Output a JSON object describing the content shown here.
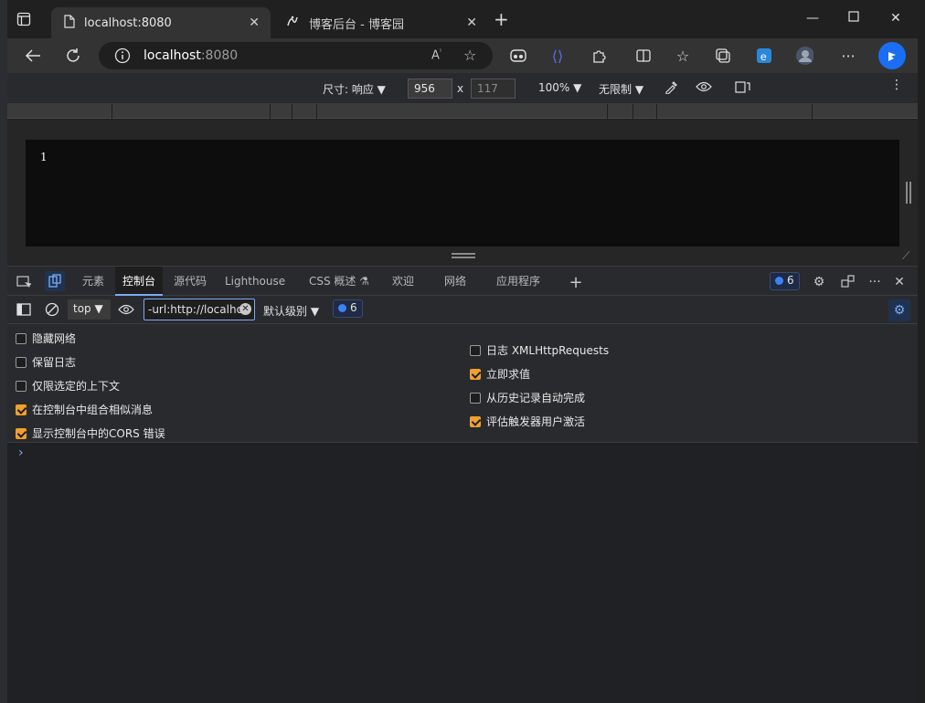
{
  "tabs": [
    {
      "title": "localhost:8080",
      "active": true
    },
    {
      "title": "博客后台 - 博客园",
      "active": false
    }
  ],
  "address": {
    "host": "localhost",
    "port": ":8080"
  },
  "device_toolbar": {
    "dimensions_label": "尺寸: 响应",
    "width": "956",
    "times": "x",
    "height": "117",
    "zoom": "100%",
    "throttle": "无限制"
  },
  "page": {
    "content": "1"
  },
  "devtools": {
    "tabs": [
      "元素",
      "控制台",
      "源代码",
      "Lighthouse",
      "CSS 概述",
      "欢迎",
      "网络",
      "应用程序"
    ],
    "active_tab": "控制台",
    "issues_count": "6"
  },
  "console_bar": {
    "context": "top",
    "filter_value": "-url:http://localhos",
    "levels": "默认级别",
    "issues_count": "6"
  },
  "settings": {
    "left": [
      {
        "label": "隐藏网络",
        "checked": false
      },
      {
        "label": "保留日志",
        "checked": false
      },
      {
        "label": "仅限选定的上下文",
        "checked": false
      },
      {
        "label": "在控制台中组合相似消息",
        "checked": true
      },
      {
        "label": "显示控制台中的CORS 错误",
        "checked": true
      }
    ],
    "right": [
      {
        "label": "日志 XMLHttpRequests",
        "checked": false
      },
      {
        "label": "立即求值",
        "checked": true
      },
      {
        "label": "从历史记录自动完成",
        "checked": false
      },
      {
        "label": "评估触发器用户激活",
        "checked": true
      }
    ]
  },
  "colors": {
    "accent": "#7cacf8",
    "checkbox_on": "#f0a030"
  }
}
